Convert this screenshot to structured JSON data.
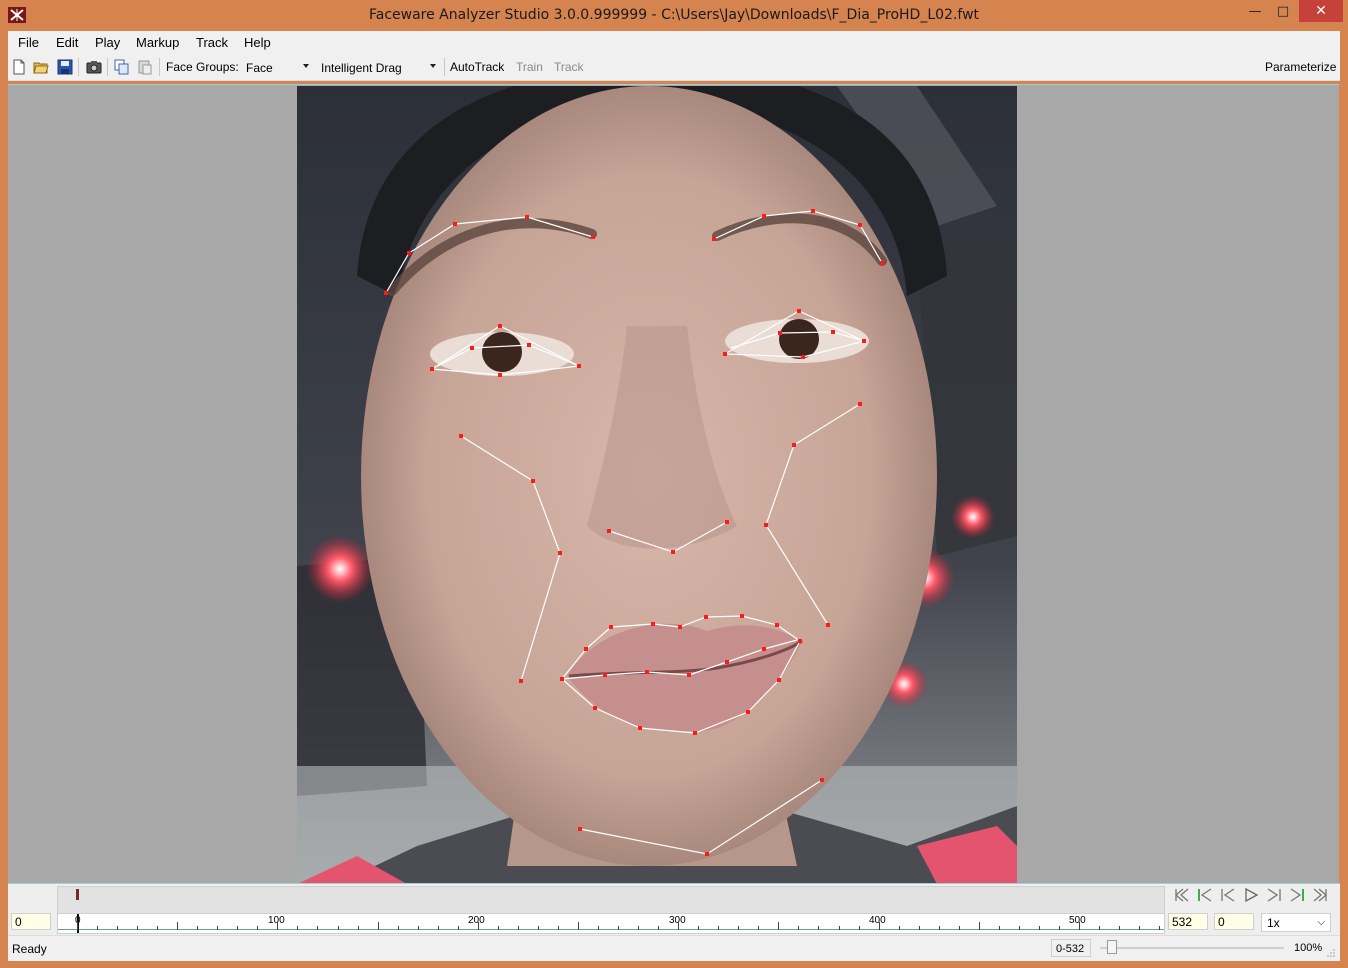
{
  "window": {
    "title": "Faceware Analyzer Studio 3.0.0.999999 - C:\\Users\\Jay\\Downloads\\F_Dia_ProHD_L02.fwt",
    "accent": "#d6844f",
    "close_color": "#c7413b"
  },
  "menu": {
    "items": [
      "File",
      "Edit",
      "Play",
      "Markup",
      "Track",
      "Help"
    ]
  },
  "toolbar": {
    "icons": [
      "new-file-icon",
      "open-folder-icon",
      "save-icon",
      "camera-icon",
      "copy-icon",
      "paste-icon"
    ],
    "face_groups_label": "Face Groups:",
    "face_groups_value": "Face",
    "drag_mode_value": "Intelligent Drag",
    "autotrack_label": "AutoTrack",
    "train_label": "Train",
    "track_label": "Track",
    "parameterize_label": "Parameterize"
  },
  "timeline": {
    "current_frame": "0",
    "ruler_labels": [
      "0",
      "100",
      "200",
      "300",
      "400",
      "500"
    ],
    "end_frame": "532",
    "offset": "0",
    "speed": "1x",
    "nav_icons": [
      "first-frame-icon",
      "prev-key-icon",
      "prev-frame-icon",
      "play-icon",
      "next-frame-icon",
      "next-key-icon",
      "last-frame-icon"
    ]
  },
  "status": {
    "text": "Ready",
    "range": "0-532",
    "zoom": "100%"
  }
}
